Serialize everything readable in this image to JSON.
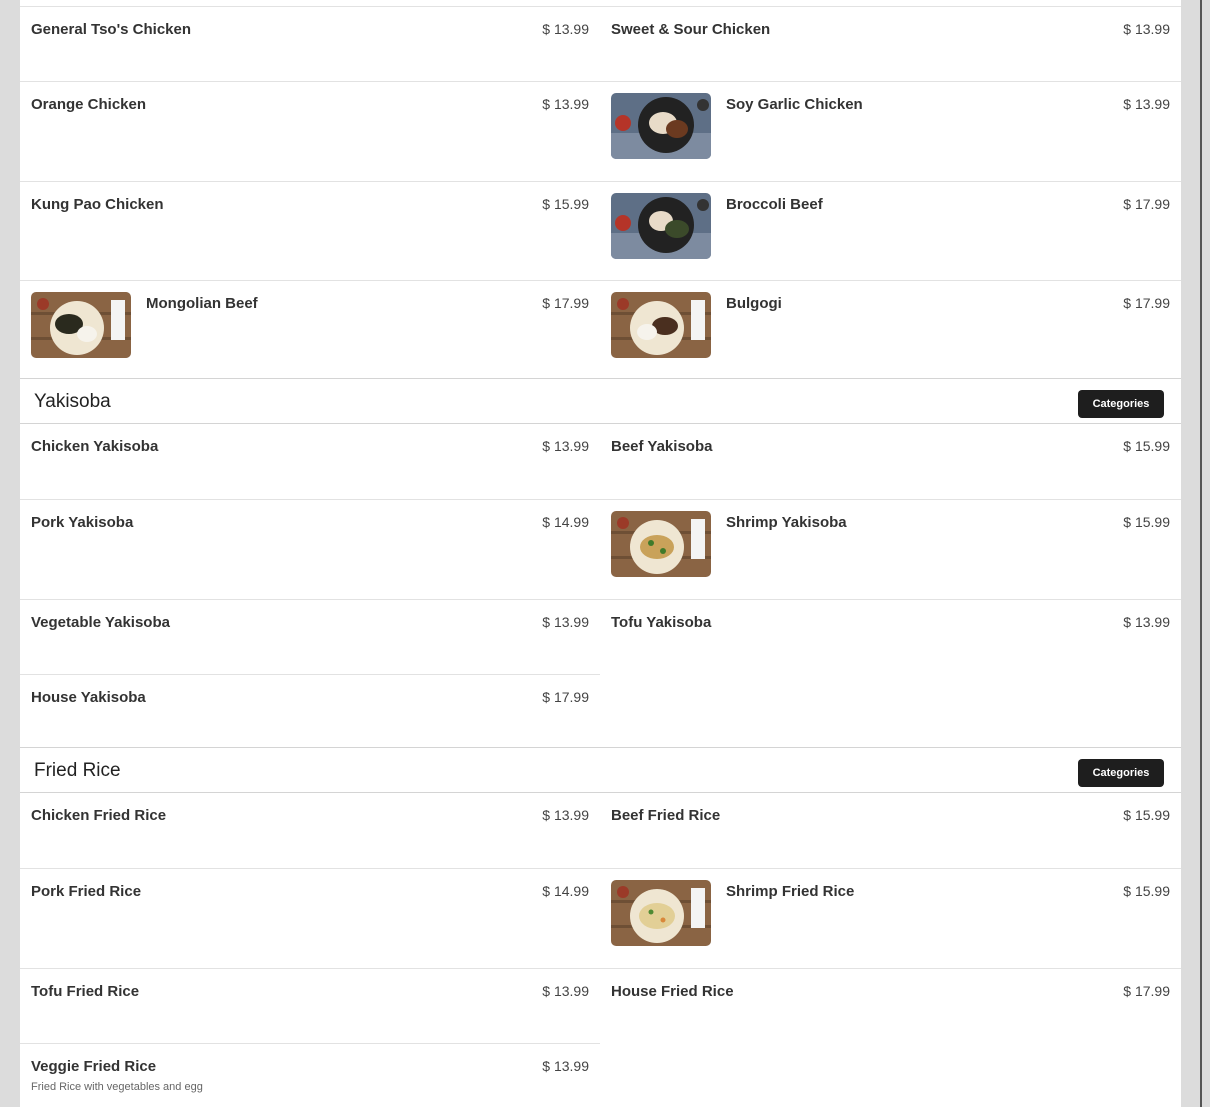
{
  "sections": {
    "meat": {
      "items": [
        {
          "name": "General Tso's Chicken",
          "price": "$ 13.99"
        },
        {
          "name": "Sweet & Sour Chicken",
          "price": "$ 13.99"
        },
        {
          "name": "Orange Chicken",
          "price": "$ 13.99"
        },
        {
          "name": "Soy Garlic Chicken",
          "price": "$ 13.99",
          "image": "chicken-plate-image"
        },
        {
          "name": "Kung Pao Chicken",
          "price": "$ 15.99"
        },
        {
          "name": "Broccoli Beef",
          "price": "$ 17.99",
          "image": "beef-plate-image"
        },
        {
          "name": "Mongolian Beef",
          "price": "$ 17.99",
          "image": "beef-dish-image"
        },
        {
          "name": "Bulgogi",
          "price": "$ 17.99",
          "image": "bulgogi-dish-image"
        }
      ]
    },
    "yakisoba": {
      "title": "Yakisoba",
      "categories_label": "Categories",
      "items": [
        {
          "name": "Chicken Yakisoba",
          "price": "$ 13.99"
        },
        {
          "name": "Beef Yakisoba",
          "price": "$ 15.99"
        },
        {
          "name": "Pork Yakisoba",
          "price": "$ 14.99"
        },
        {
          "name": "Shrimp Yakisoba",
          "price": "$ 15.99",
          "image": "noodle-dish-image"
        },
        {
          "name": "Vegetable Yakisoba",
          "price": "$ 13.99"
        },
        {
          "name": "Tofu Yakisoba",
          "price": "$ 13.99"
        },
        {
          "name": "House Yakisoba",
          "price": "$ 17.99"
        }
      ]
    },
    "fried_rice": {
      "title": "Fried Rice",
      "categories_label": "Categories",
      "items": [
        {
          "name": "Chicken Fried Rice",
          "price": "$ 13.99"
        },
        {
          "name": "Beef Fried Rice",
          "price": "$ 15.99"
        },
        {
          "name": "Pork Fried Rice",
          "price": "$ 14.99"
        },
        {
          "name": "Shrimp Fried Rice",
          "price": "$ 15.99",
          "image": "rice-dish-image"
        },
        {
          "name": "Tofu Fried Rice",
          "price": "$ 13.99"
        },
        {
          "name": "House Fried Rice",
          "price": "$ 17.99"
        },
        {
          "name": "Veggie Fried Rice",
          "price": "$ 13.99",
          "description": "Fried Rice with vegetables and egg"
        }
      ]
    }
  },
  "colors": {
    "button_bg": "#1e1e1e",
    "divider": "#e2e2e2",
    "page_bg": "#dcdcdc"
  }
}
